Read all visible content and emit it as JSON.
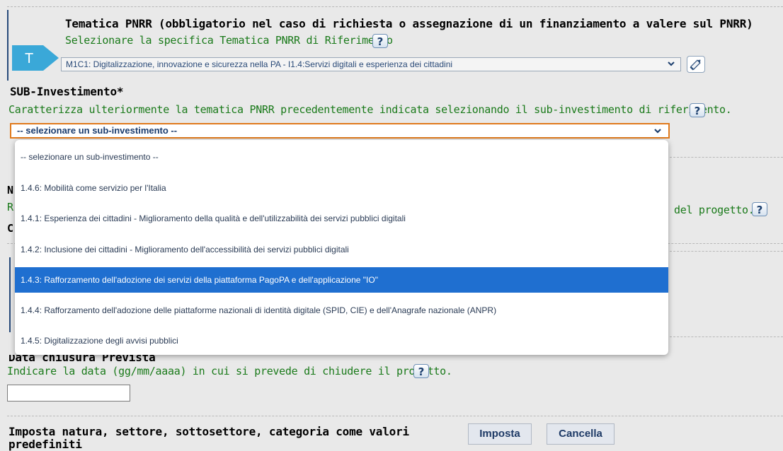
{
  "tematica": {
    "title": "Tematica PNRR (obbligatorio nel caso di richiesta o assegnazione di un finanziamento a valere sul PNRR)",
    "instruction": "Selezionare la specifica Tematica PNRR di Riferimento",
    "selected_value": "M1C1: Digitalizzazione, innovazione e sicurezza nella PA - I1.4:Servizi digitali e esperienza dei cittadini",
    "badge_letter": "T",
    "badge_color": "#3aa8d8"
  },
  "sub_investimento": {
    "title": "SUB-Investimento*",
    "instruction": "Caratterizza ulteriormente la tematica PNRR precedentemente indicata selezionando il sub-investimento di riferimento.",
    "selected_value": "-- selezionare un sub-investimento --",
    "options": [
      "-- selezionare un sub-investimento --",
      "1.4.6: Mobilità come servizio per l'Italia",
      "1.4.1: Esperienza dei cittadini - Miglioramento della qualità e dell'utilizzabilità dei servizi pubblici digitali",
      "1.4.2: Inclusione dei cittadini - Miglioramento dell'accessibilità dei servizi pubblici digitali",
      "1.4.3: Rafforzamento dell'adozione dei servizi della piattaforma PagoPA e dell'applicazione \"IO\"",
      "1.4.4: Rafforzamento dell'adozione delle piattaforme nazionali di identità digitale (SPID, CIE) e dell'Anagrafe nazionale (ANPR)",
      "1.4.5: Digitalizzazione degli avvisi pubblici"
    ],
    "highlighted_index": 4,
    "highlight_color": "#1f6fd0",
    "focus_color": "#e07a1c"
  },
  "partial_behind": {
    "n_letter": "N",
    "r_letter": "R",
    "c_letter": "C",
    "progetto_tail": "del progetto."
  },
  "data_chiusura": {
    "title_partial": "Data chiusura Prevista",
    "instruction": "Indicare la data (gg/mm/aaaa) in cui si prevede di chiudere il progetto.",
    "value": ""
  },
  "footer": {
    "label": "Imposta natura, settore, sottosettore, categoria come valori predefiniti",
    "imposta_button": "Imposta",
    "cancella_button": "Cancella"
  },
  "help_symbol": "?"
}
